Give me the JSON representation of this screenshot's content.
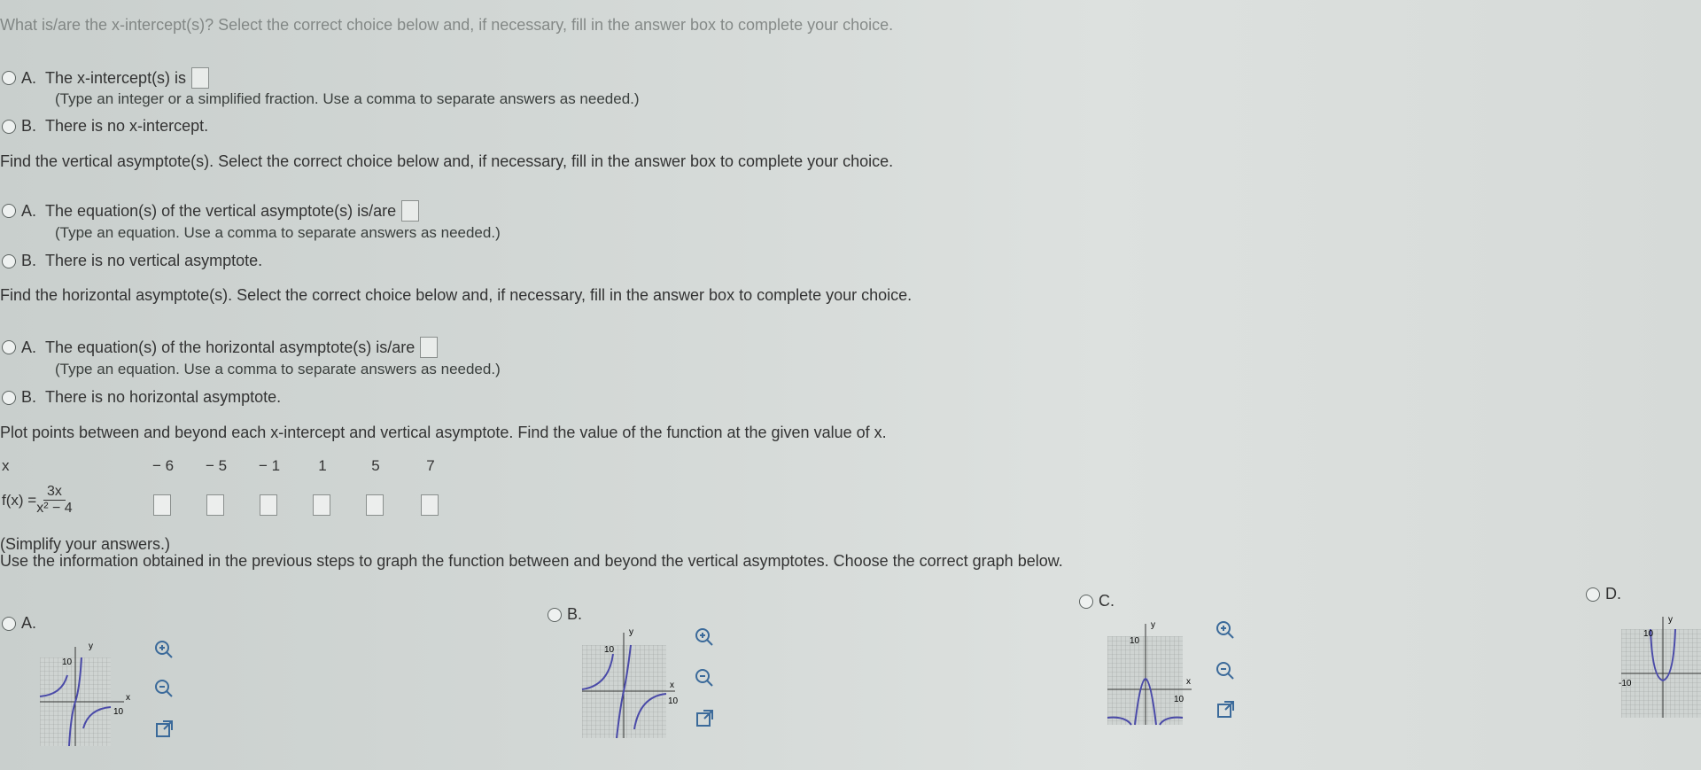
{
  "top_instruction": "What is/are the x-intercept(s)? Select the correct choice below and, if necessary, fill in the answer box to complete your choice.",
  "xint": {
    "a_letter": "A.",
    "a_text": "The x-intercept(s) is",
    "a_hint": "(Type an integer or a simplified fraction. Use a comma to separate answers as needed.)",
    "b_letter": "B.",
    "b_text": "There is no x-intercept."
  },
  "vert": {
    "prompt": "Find the vertical asymptote(s). Select the correct choice below and, if necessary, fill in the answer box to complete your choice.",
    "a_letter": "A.",
    "a_text": "The equation(s) of the vertical asymptote(s) is/are",
    "a_hint": "(Type an equation. Use a comma to separate answers as needed.)",
    "b_letter": "B.",
    "b_text": "There is no vertical asymptote."
  },
  "horiz": {
    "prompt": "Find the horizontal asymptote(s). Select the correct choice below and, if necessary, fill in the answer box to complete your choice.",
    "a_letter": "A.",
    "a_text": "The equation(s) of the horizontal asymptote(s) is/are",
    "a_hint": "(Type an equation. Use a comma to separate answers as needed.)",
    "b_letter": "B.",
    "b_text": "There is no horizontal asymptote."
  },
  "plot": {
    "prompt": "Plot points between and beyond each x-intercept and vertical asymptote. Find the value of the function at the given value of x.",
    "x_label": "x",
    "x_values": [
      "− 6",
      "− 5",
      "− 1",
      "1",
      "5",
      "7"
    ],
    "f_label": "f(x) =",
    "f_num": "3x",
    "f_den": "x² − 4",
    "simplify_note": "(Simplify your answers.)"
  },
  "graph": {
    "prompt": "Use the information obtained in the previous steps to graph the function between and beyond the vertical asymptotes. Choose the correct graph below.",
    "options": [
      "A.",
      "B.",
      "C.",
      "D."
    ],
    "axis_x": "x",
    "axis_y": "y",
    "tick_pos": "10",
    "tick_neg": "-10"
  },
  "colors": {
    "curve": "#4a4aa8",
    "grid": "#9aa09e",
    "gridbg": "#cfd4d2"
  }
}
